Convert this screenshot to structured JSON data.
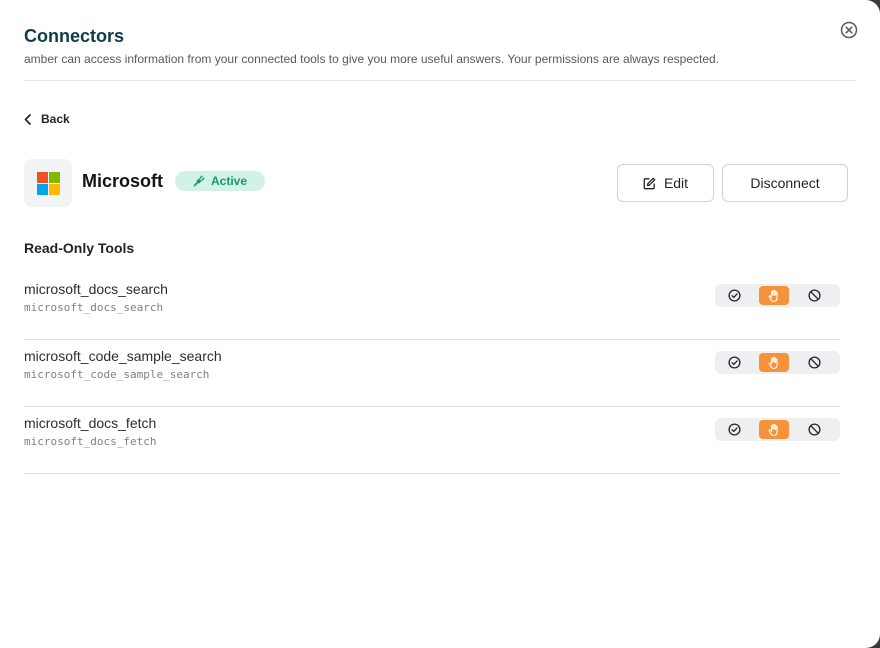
{
  "header": {
    "title": "Connectors",
    "subtitle": "amber can access information from your connected tools to give you more useful answers. Your permissions are always respected."
  },
  "nav": {
    "back_label": "Back"
  },
  "connector": {
    "name": "Microsoft",
    "status": "Active",
    "logo_colors": [
      "#f25022",
      "#7fba00",
      "#00a4ef",
      "#ffb900"
    ],
    "edit_label": "Edit",
    "disconnect_label": "Disconnect"
  },
  "tools_section": {
    "title": "Read-Only Tools",
    "items": [
      {
        "name": "microsoft_docs_search",
        "id": "microsoft_docs_search",
        "permission": "ask"
      },
      {
        "name": "microsoft_code_sample_search",
        "id": "microsoft_code_sample_search",
        "permission": "ask"
      },
      {
        "name": "microsoft_docs_fetch",
        "id": "microsoft_docs_fetch",
        "permission": "ask"
      }
    ],
    "permission_options": [
      "allow",
      "ask",
      "deny"
    ]
  },
  "colors": {
    "title": "#0f3b47",
    "accent_active_permission": "#f6923a",
    "badge_bg": "#d3f2e6",
    "badge_text": "#159a6b"
  },
  "icons": {
    "close": "close-circle-icon",
    "back": "chevron-left-icon",
    "badge": "plug-icon",
    "edit": "edit-icon",
    "allow": "check-circle-icon",
    "ask": "hand-icon",
    "deny": "block-icon"
  }
}
